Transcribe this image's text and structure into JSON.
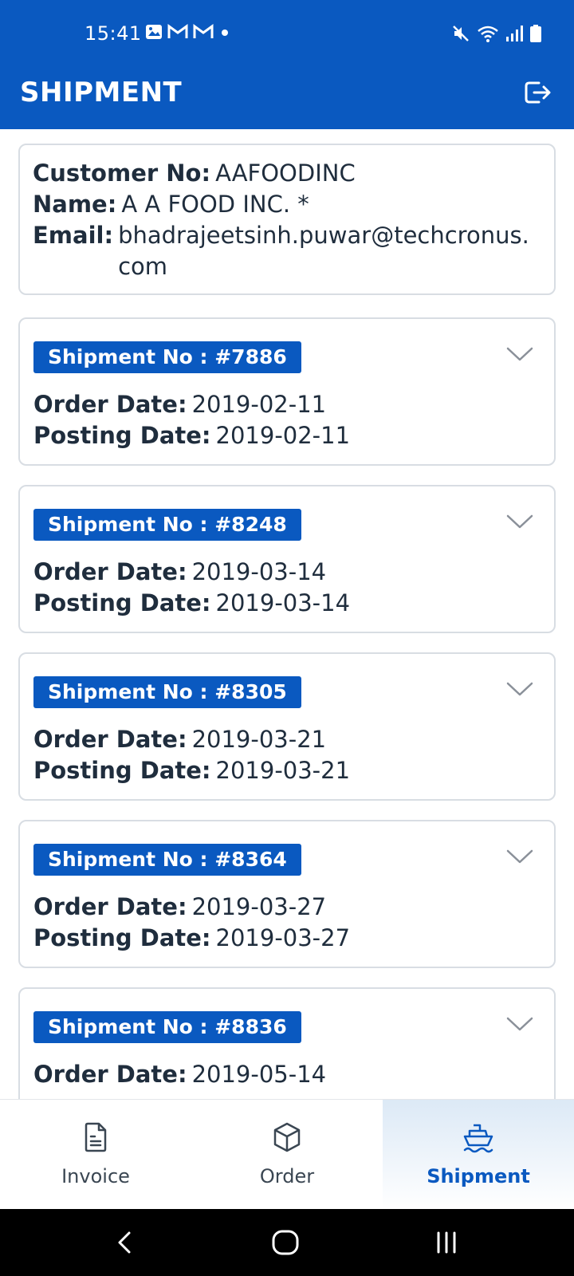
{
  "status_bar": {
    "time": "15:41"
  },
  "app_bar": {
    "title": "SHIPMENT"
  },
  "customer": {
    "customer_no_label": "Customer No:",
    "customer_no": "AAFOODINC",
    "name_label": "Name:",
    "name": "A A FOOD INC. *",
    "email_label": "Email:",
    "email": "bhadrajeetsinh.puwar@techcronus.com"
  },
  "shipment_labels": {
    "order_date": "Order Date:",
    "posting_date": "Posting Date:"
  },
  "shipments": [
    {
      "title": "Shipment No : #7886",
      "order_date": "2019-02-11",
      "posting_date": "2019-02-11"
    },
    {
      "title": "Shipment No : #8248",
      "order_date": "2019-03-14",
      "posting_date": "2019-03-14"
    },
    {
      "title": "Shipment No : #8305",
      "order_date": "2019-03-21",
      "posting_date": "2019-03-21"
    },
    {
      "title": "Shipment No : #8364",
      "order_date": "2019-03-27",
      "posting_date": "2019-03-27"
    },
    {
      "title": "Shipment No : #8836",
      "order_date": "2019-05-14"
    }
  ],
  "bottom_nav": {
    "items": [
      {
        "label": "Invoice",
        "icon": "document-icon",
        "active": false
      },
      {
        "label": "Order",
        "icon": "box-icon",
        "active": false
      },
      {
        "label": "Shipment",
        "icon": "ship-icon",
        "active": true
      }
    ]
  },
  "colors": {
    "primary": "#0a59c0",
    "border": "#d8dde3",
    "text": "#1f2d3d"
  }
}
